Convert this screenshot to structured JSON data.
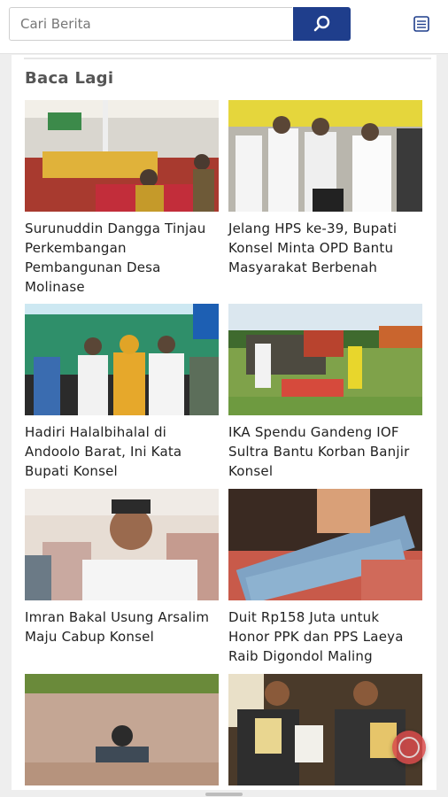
{
  "search": {
    "placeholder": "Cari Berita",
    "button_icon": "search-icon"
  },
  "menu": {
    "icon": "menu-icon"
  },
  "section": {
    "title": "Baca Lagi"
  },
  "articles": [
    {
      "title": "Surunuddin Dangga Tinjau Perkembangan Pembangunan Desa Molinase"
    },
    {
      "title": "Jelang HPS ke-39, Bupati Konsel Minta OPD Bantu Masyarakat Berbenah"
    },
    {
      "title": "Hadiri Halalbihalal di Andoolo Barat, Ini Kata Bupati Konsel"
    },
    {
      "title": "IKA Spendu Gandeng IOF Sultra Bantu Korban Banjir Konsel"
    },
    {
      "title": "Imran Bakal Usung Arsalim Maju Cabup Konsel"
    },
    {
      "title": "Duit Rp158 Juta untuk Honor PPK dan PPS Laeya Raib Digondol Maling"
    },
    {
      "title": ""
    },
    {
      "title": ""
    }
  ],
  "colors": {
    "accent": "#1f3e8c",
    "text": "#222222",
    "section_title": "#555555"
  }
}
